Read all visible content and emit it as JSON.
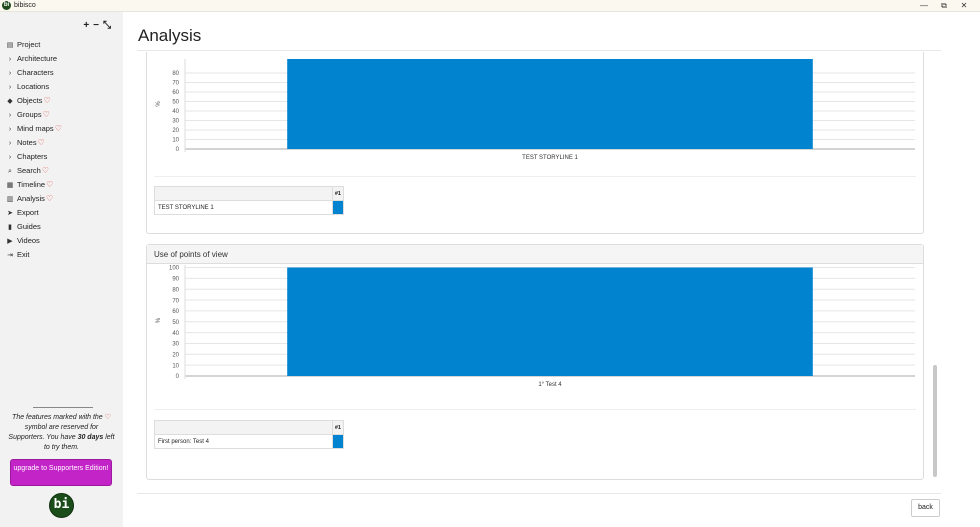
{
  "window": {
    "title": "bibisco",
    "logo": "bi",
    "minimize": "—",
    "restore": "⧉",
    "close": "✕"
  },
  "sidebar": {
    "tools": [
      "+",
      "−",
      "⤡"
    ],
    "items": [
      {
        "label": "Project",
        "icon": "project-icon",
        "glyph": "▤",
        "heart": false
      },
      {
        "label": "Architecture",
        "icon": "chevron-right-icon",
        "glyph": "›",
        "heart": false
      },
      {
        "label": "Characters",
        "icon": "chevron-right-icon",
        "glyph": "›",
        "heart": false
      },
      {
        "label": "Locations",
        "icon": "chevron-right-icon",
        "glyph": "›",
        "heart": false
      },
      {
        "label": "Objects",
        "icon": "objects-icon",
        "glyph": "◆",
        "heart": true
      },
      {
        "label": "Groups",
        "icon": "chevron-right-icon",
        "glyph": "›",
        "heart": true
      },
      {
        "label": "Mind maps",
        "icon": "chevron-right-icon",
        "glyph": "›",
        "heart": true
      },
      {
        "label": "Notes",
        "icon": "chevron-right-icon",
        "glyph": "›",
        "heart": true
      },
      {
        "label": "Chapters",
        "icon": "chevron-right-icon",
        "glyph": "›",
        "heart": false
      },
      {
        "label": "Search",
        "icon": "search-icon",
        "glyph": "⌕",
        "heart": true
      },
      {
        "label": "Timeline",
        "icon": "calendar-icon",
        "glyph": "▦",
        "heart": true
      },
      {
        "label": "Analysis",
        "icon": "chart-icon",
        "glyph": "▥",
        "heart": true
      },
      {
        "label": "Export",
        "icon": "send-icon",
        "glyph": "➤",
        "heart": false
      },
      {
        "label": "Guides",
        "icon": "book-icon",
        "glyph": "▮",
        "heart": false
      },
      {
        "label": "Videos",
        "icon": "video-icon",
        "glyph": "▶",
        "heart": false
      },
      {
        "label": "Exit",
        "icon": "exit-icon",
        "glyph": "⇥",
        "heart": false
      }
    ],
    "note_pre": "The features marked with the",
    "note_mid": "symbol are reserved for Supporters. You have",
    "note_days": "30 days",
    "note_post": "left to try them.",
    "upgrade_label": "upgrade to Supporters Edition!",
    "logo": "bi"
  },
  "main": {
    "title": "Analysis",
    "back_label": "back"
  },
  "chart_data": [
    {
      "type": "bar",
      "ylabel": "%",
      "categories": [
        "TEST STORYLINE 1"
      ],
      "series": [
        {
          "name": "#1",
          "values": [
            100
          ],
          "color": "#0283d0"
        }
      ],
      "ylim": [
        0,
        100
      ],
      "yticks": [
        0,
        10,
        20,
        30,
        40,
        50,
        60,
        70,
        80
      ],
      "grid": true,
      "legend_table": {
        "header": "#1",
        "rows": [
          "TEST STORYLINE 1"
        ]
      }
    },
    {
      "type": "bar",
      "title": "Use of points of view",
      "ylabel": "%",
      "categories": [
        "1° Test 4"
      ],
      "series": [
        {
          "name": "#1",
          "values": [
            100
          ],
          "color": "#0283d0"
        }
      ],
      "ylim": [
        0,
        100
      ],
      "yticks": [
        0,
        10,
        20,
        30,
        40,
        50,
        60,
        70,
        80,
        90,
        100
      ],
      "grid": true,
      "legend_table": {
        "header": "#1",
        "rows": [
          "First person: Test 4"
        ]
      }
    }
  ]
}
